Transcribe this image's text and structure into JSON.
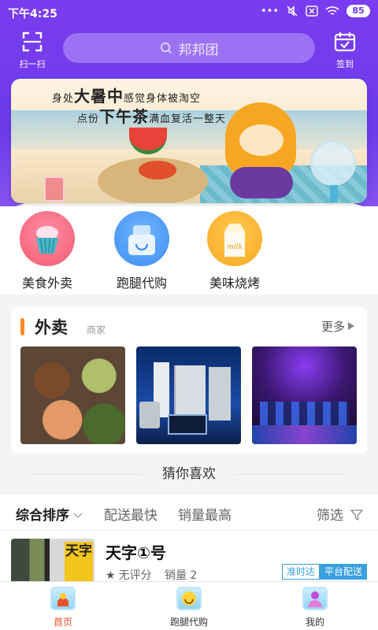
{
  "status_bar": {
    "time": "下午4:25",
    "battery": "85",
    "icons": [
      "dots-icon",
      "mute-icon",
      "sim-off-icon",
      "wifi-icon",
      "battery-icon"
    ]
  },
  "header": {
    "scan_label": "扫一扫",
    "search_placeholder": "邦邦团",
    "signin_label": "签到"
  },
  "banner": {
    "line1_a": "身处",
    "line1_b": "大暑中",
    "line1_c": "感觉身体被淘空",
    "line2_a": "点份",
    "line2_b": "下午茶",
    "line2_c": "满血复活一整天"
  },
  "quick_entries": [
    {
      "label": "美食外卖",
      "icon": "cupcake-icon",
      "color": "#f25a6e"
    },
    {
      "label": "跑腿代购",
      "icon": "shopping-bag-icon",
      "color": "#3f8ef0"
    },
    {
      "label": "美味烧烤",
      "icon": "milk-carton-icon",
      "color": "#f9a825"
    }
  ],
  "takeaway": {
    "title": "外卖",
    "subtitle": "商家",
    "more": "更多",
    "images": [
      "dishes",
      "home-appliances",
      "ktv-room"
    ]
  },
  "guess": {
    "title": "猜你喜欢"
  },
  "sort": {
    "items": [
      "综合排序",
      "配送最快",
      "销量最高"
    ],
    "filter": "筛选"
  },
  "shop": {
    "name": "天字①号",
    "sign": "天字",
    "rating": "无评分",
    "sales": "销量 2",
    "tags": [
      "准时达",
      "平台配送"
    ]
  },
  "tabbar": {
    "items": [
      {
        "label": "首页",
        "active": true
      },
      {
        "label": "跑腿代购",
        "active": false
      },
      {
        "label": "我的",
        "active": false
      }
    ],
    "active_color": "#e8532b"
  },
  "colors": {
    "header_purple": "#6b3be8",
    "accent_orange": "#ff8a1f",
    "tag_blue": "#39a0e0"
  }
}
